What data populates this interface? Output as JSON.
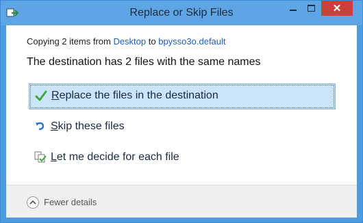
{
  "window": {
    "title": "Replace or Skip Files",
    "controls": {
      "minimize": "minimize",
      "maximize": "maximize",
      "close": "✕"
    }
  },
  "copying": {
    "prefix": "Copying 2 items from ",
    "source": "Desktop",
    "mid": " to ",
    "destination": "bpysso3o.default"
  },
  "heading": "The destination has 2 files with the same names",
  "options": [
    {
      "icon": "checkmark-icon",
      "first": "R",
      "rest": "eplace the files in the destination",
      "selected": true
    },
    {
      "icon": "skip-arrow-icon",
      "first": "S",
      "rest": "kip these files",
      "selected": false
    },
    {
      "icon": "decide-files-icon",
      "first": "L",
      "rest": "et me decide for each file",
      "selected": false
    }
  ],
  "footer": {
    "toggle_label": "Fewer details"
  },
  "colors": {
    "titlebar": "#5ea5e6",
    "close": "#c9413a",
    "link": "#1f5fc1",
    "selected_bg": "#cce4f7",
    "check": "#3ca83c"
  }
}
